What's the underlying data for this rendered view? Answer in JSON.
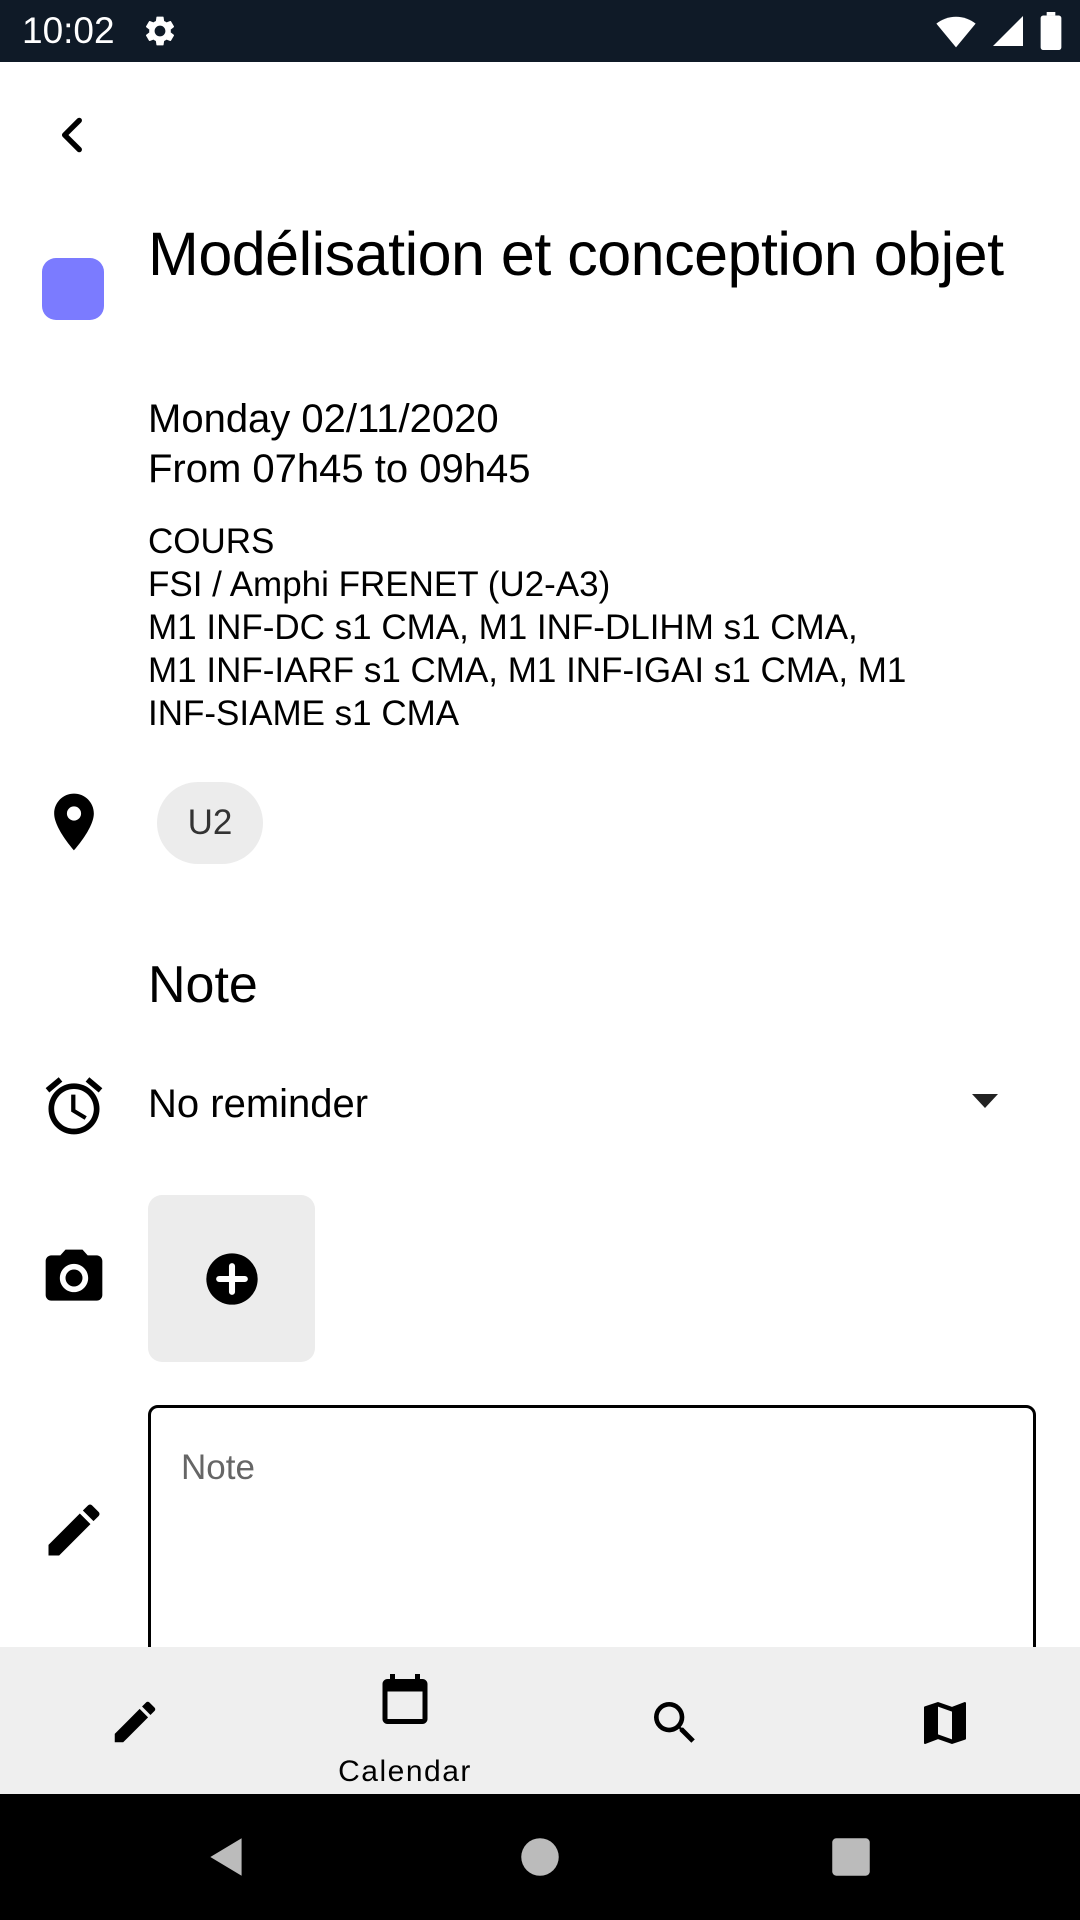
{
  "status_bar": {
    "time": "10:02"
  },
  "event": {
    "color": "#7b7bff",
    "title": "Modélisation et conception objet",
    "date": "Monday 02/11/2020",
    "time_range": "From 07h45 to 09h45",
    "type": "COURS",
    "room": "FSI / Amphi FRENET (U2-A3)",
    "groups_line1": "M1 INF-DC s1 CMA, M1 INF-DLIHM s1 CMA,",
    "groups_line2": "M1 INF-IARF s1 CMA, M1 INF-IGAI s1 CMA, M1",
    "groups_line3": "INF-SIAME s1 CMA",
    "location_chip": "U2"
  },
  "note_section": {
    "heading": "Note",
    "reminder_value": "No reminder",
    "note_placeholder": "Note"
  },
  "bottom_nav": {
    "calendar_label": "Calendar"
  }
}
